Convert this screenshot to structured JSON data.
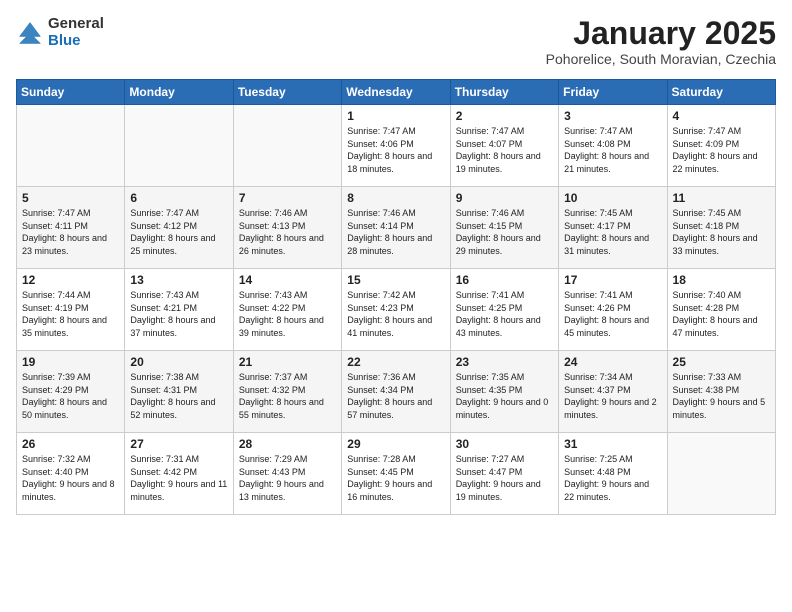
{
  "header": {
    "logo_general": "General",
    "logo_blue": "Blue",
    "month_title": "January 2025",
    "location": "Pohorelice, South Moravian, Czechia"
  },
  "days_of_week": [
    "Sunday",
    "Monday",
    "Tuesday",
    "Wednesday",
    "Thursday",
    "Friday",
    "Saturday"
  ],
  "weeks": [
    [
      {
        "day": "",
        "info": ""
      },
      {
        "day": "",
        "info": ""
      },
      {
        "day": "",
        "info": ""
      },
      {
        "day": "1",
        "info": "Sunrise: 7:47 AM\nSunset: 4:06 PM\nDaylight: 8 hours\nand 18 minutes."
      },
      {
        "day": "2",
        "info": "Sunrise: 7:47 AM\nSunset: 4:07 PM\nDaylight: 8 hours\nand 19 minutes."
      },
      {
        "day": "3",
        "info": "Sunrise: 7:47 AM\nSunset: 4:08 PM\nDaylight: 8 hours\nand 21 minutes."
      },
      {
        "day": "4",
        "info": "Sunrise: 7:47 AM\nSunset: 4:09 PM\nDaylight: 8 hours\nand 22 minutes."
      }
    ],
    [
      {
        "day": "5",
        "info": "Sunrise: 7:47 AM\nSunset: 4:11 PM\nDaylight: 8 hours\nand 23 minutes."
      },
      {
        "day": "6",
        "info": "Sunrise: 7:47 AM\nSunset: 4:12 PM\nDaylight: 8 hours\nand 25 minutes."
      },
      {
        "day": "7",
        "info": "Sunrise: 7:46 AM\nSunset: 4:13 PM\nDaylight: 8 hours\nand 26 minutes."
      },
      {
        "day": "8",
        "info": "Sunrise: 7:46 AM\nSunset: 4:14 PM\nDaylight: 8 hours\nand 28 minutes."
      },
      {
        "day": "9",
        "info": "Sunrise: 7:46 AM\nSunset: 4:15 PM\nDaylight: 8 hours\nand 29 minutes."
      },
      {
        "day": "10",
        "info": "Sunrise: 7:45 AM\nSunset: 4:17 PM\nDaylight: 8 hours\nand 31 minutes."
      },
      {
        "day": "11",
        "info": "Sunrise: 7:45 AM\nSunset: 4:18 PM\nDaylight: 8 hours\nand 33 minutes."
      }
    ],
    [
      {
        "day": "12",
        "info": "Sunrise: 7:44 AM\nSunset: 4:19 PM\nDaylight: 8 hours\nand 35 minutes."
      },
      {
        "day": "13",
        "info": "Sunrise: 7:43 AM\nSunset: 4:21 PM\nDaylight: 8 hours\nand 37 minutes."
      },
      {
        "day": "14",
        "info": "Sunrise: 7:43 AM\nSunset: 4:22 PM\nDaylight: 8 hours\nand 39 minutes."
      },
      {
        "day": "15",
        "info": "Sunrise: 7:42 AM\nSunset: 4:23 PM\nDaylight: 8 hours\nand 41 minutes."
      },
      {
        "day": "16",
        "info": "Sunrise: 7:41 AM\nSunset: 4:25 PM\nDaylight: 8 hours\nand 43 minutes."
      },
      {
        "day": "17",
        "info": "Sunrise: 7:41 AM\nSunset: 4:26 PM\nDaylight: 8 hours\nand 45 minutes."
      },
      {
        "day": "18",
        "info": "Sunrise: 7:40 AM\nSunset: 4:28 PM\nDaylight: 8 hours\nand 47 minutes."
      }
    ],
    [
      {
        "day": "19",
        "info": "Sunrise: 7:39 AM\nSunset: 4:29 PM\nDaylight: 8 hours\nand 50 minutes."
      },
      {
        "day": "20",
        "info": "Sunrise: 7:38 AM\nSunset: 4:31 PM\nDaylight: 8 hours\nand 52 minutes."
      },
      {
        "day": "21",
        "info": "Sunrise: 7:37 AM\nSunset: 4:32 PM\nDaylight: 8 hours\nand 55 minutes."
      },
      {
        "day": "22",
        "info": "Sunrise: 7:36 AM\nSunset: 4:34 PM\nDaylight: 8 hours\nand 57 minutes."
      },
      {
        "day": "23",
        "info": "Sunrise: 7:35 AM\nSunset: 4:35 PM\nDaylight: 9 hours\nand 0 minutes."
      },
      {
        "day": "24",
        "info": "Sunrise: 7:34 AM\nSunset: 4:37 PM\nDaylight: 9 hours\nand 2 minutes."
      },
      {
        "day": "25",
        "info": "Sunrise: 7:33 AM\nSunset: 4:38 PM\nDaylight: 9 hours\nand 5 minutes."
      }
    ],
    [
      {
        "day": "26",
        "info": "Sunrise: 7:32 AM\nSunset: 4:40 PM\nDaylight: 9 hours\nand 8 minutes."
      },
      {
        "day": "27",
        "info": "Sunrise: 7:31 AM\nSunset: 4:42 PM\nDaylight: 9 hours\nand 11 minutes."
      },
      {
        "day": "28",
        "info": "Sunrise: 7:29 AM\nSunset: 4:43 PM\nDaylight: 9 hours\nand 13 minutes."
      },
      {
        "day": "29",
        "info": "Sunrise: 7:28 AM\nSunset: 4:45 PM\nDaylight: 9 hours\nand 16 minutes."
      },
      {
        "day": "30",
        "info": "Sunrise: 7:27 AM\nSunset: 4:47 PM\nDaylight: 9 hours\nand 19 minutes."
      },
      {
        "day": "31",
        "info": "Sunrise: 7:25 AM\nSunset: 4:48 PM\nDaylight: 9 hours\nand 22 minutes."
      },
      {
        "day": "",
        "info": ""
      }
    ]
  ]
}
